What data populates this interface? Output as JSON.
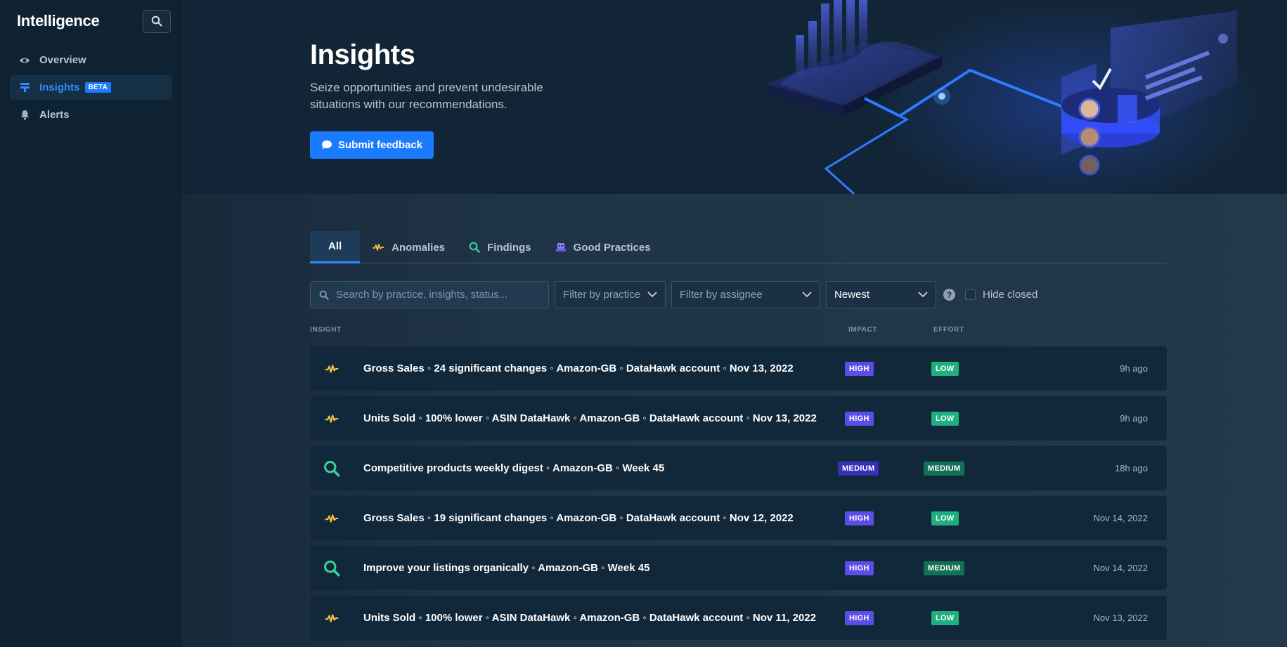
{
  "sidebar": {
    "title": "Intelligence",
    "items": [
      {
        "label": "Overview",
        "icon": "eye-icon"
      },
      {
        "label": "Insights",
        "icon": "insights-icon",
        "badge": "BETA",
        "active": true
      },
      {
        "label": "Alerts",
        "icon": "bell-icon"
      }
    ]
  },
  "hero": {
    "title": "Insights",
    "subtitle": "Seize opportunities and prevent undesirable situations with our recommendations.",
    "button": "Submit feedback"
  },
  "tabs": [
    {
      "label": "All",
      "active": true
    },
    {
      "label": "Anomalies",
      "icon": "anomaly-wave-icon"
    },
    {
      "label": "Findings",
      "icon": "magnifier-icon"
    },
    {
      "label": "Good Practices",
      "icon": "good-practices-icon"
    }
  ],
  "filters": {
    "search_placeholder": "Search by practice, insights, status...",
    "practice": "Filter by practice",
    "assignee": "Filter by assignee",
    "sort": "Newest",
    "hide_closed": "Hide closed"
  },
  "columns": {
    "insight": "INSIGHT",
    "impact": "IMPACT",
    "effort": "EFFORT"
  },
  "rows": [
    {
      "type": "anomaly",
      "title": "Gross Sales ◦ 24 significant changes ◦ Amazon-GB ◦ DataHawk account ◦ Nov 13, 2022",
      "impact": "HIGH",
      "effort": "LOW",
      "time": "9h ago"
    },
    {
      "type": "anomaly",
      "title": "Units Sold ◦ 100% lower ◦ ASIN DataHawk ◦ Amazon-GB ◦ DataHawk account ◦ Nov 13, 2022",
      "impact": "HIGH",
      "effort": "LOW",
      "time": "9h ago"
    },
    {
      "type": "finding",
      "title": "Competitive products weekly digest ◦ Amazon-GB ◦ Week 45",
      "impact": "MEDIUM",
      "effort": "MEDIUM",
      "time": "18h ago"
    },
    {
      "type": "anomaly",
      "title": "Gross Sales ◦ 19 significant changes ◦ Amazon-GB ◦ DataHawk account ◦ Nov 12, 2022",
      "impact": "HIGH",
      "effort": "LOW",
      "time": "Nov 14, 2022"
    },
    {
      "type": "finding",
      "title": "Improve your listings organically ◦ Amazon-GB ◦ Week 45",
      "impact": "HIGH",
      "effort": "MEDIUM",
      "time": "Nov 14, 2022"
    },
    {
      "type": "anomaly",
      "title": "Units Sold ◦ 100% lower ◦ ASIN DataHawk ◦ Amazon-GB ◦ DataHawk account ◦ Nov 11, 2022",
      "impact": "HIGH",
      "effort": "LOW",
      "time": "Nov 13, 2022"
    }
  ],
  "colors": {
    "accent": "#1a7bff",
    "high": "#5b4ee6",
    "medium_impact": "#3a2fb8",
    "low": "#1fb07f",
    "medium_effort": "#127057",
    "anomaly": "#f5c246",
    "finding": "#3ccf9a"
  }
}
